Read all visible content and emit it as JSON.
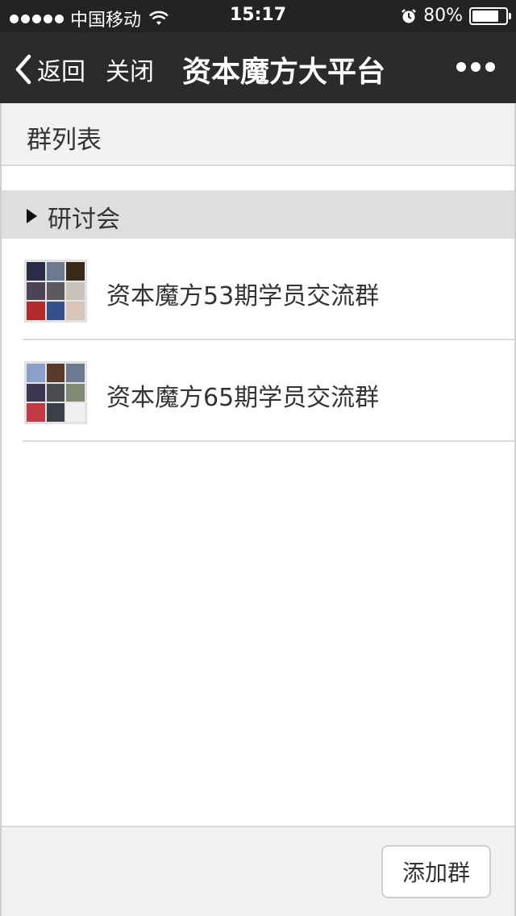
{
  "status_bar": {
    "carrier": "中国移动",
    "time": "15:17",
    "battery": "80%",
    "battery_level": 0.8
  },
  "nav": {
    "back_label": "返回",
    "close_label": "关闭",
    "title": "资本魔方大平台"
  },
  "section": {
    "title": "群列表"
  },
  "group": {
    "label": "研讨会"
  },
  "items": [
    {
      "label": "资本魔方53期学员交流群"
    },
    {
      "label": "资本魔方65期学员交流群"
    }
  ],
  "bottom": {
    "add_label": "添加群"
  },
  "colors": {
    "status_bg": "#232323",
    "nav_bg": "#2b2b2b",
    "section_bg": "#f2f2f2",
    "group_bg": "#dedede"
  }
}
